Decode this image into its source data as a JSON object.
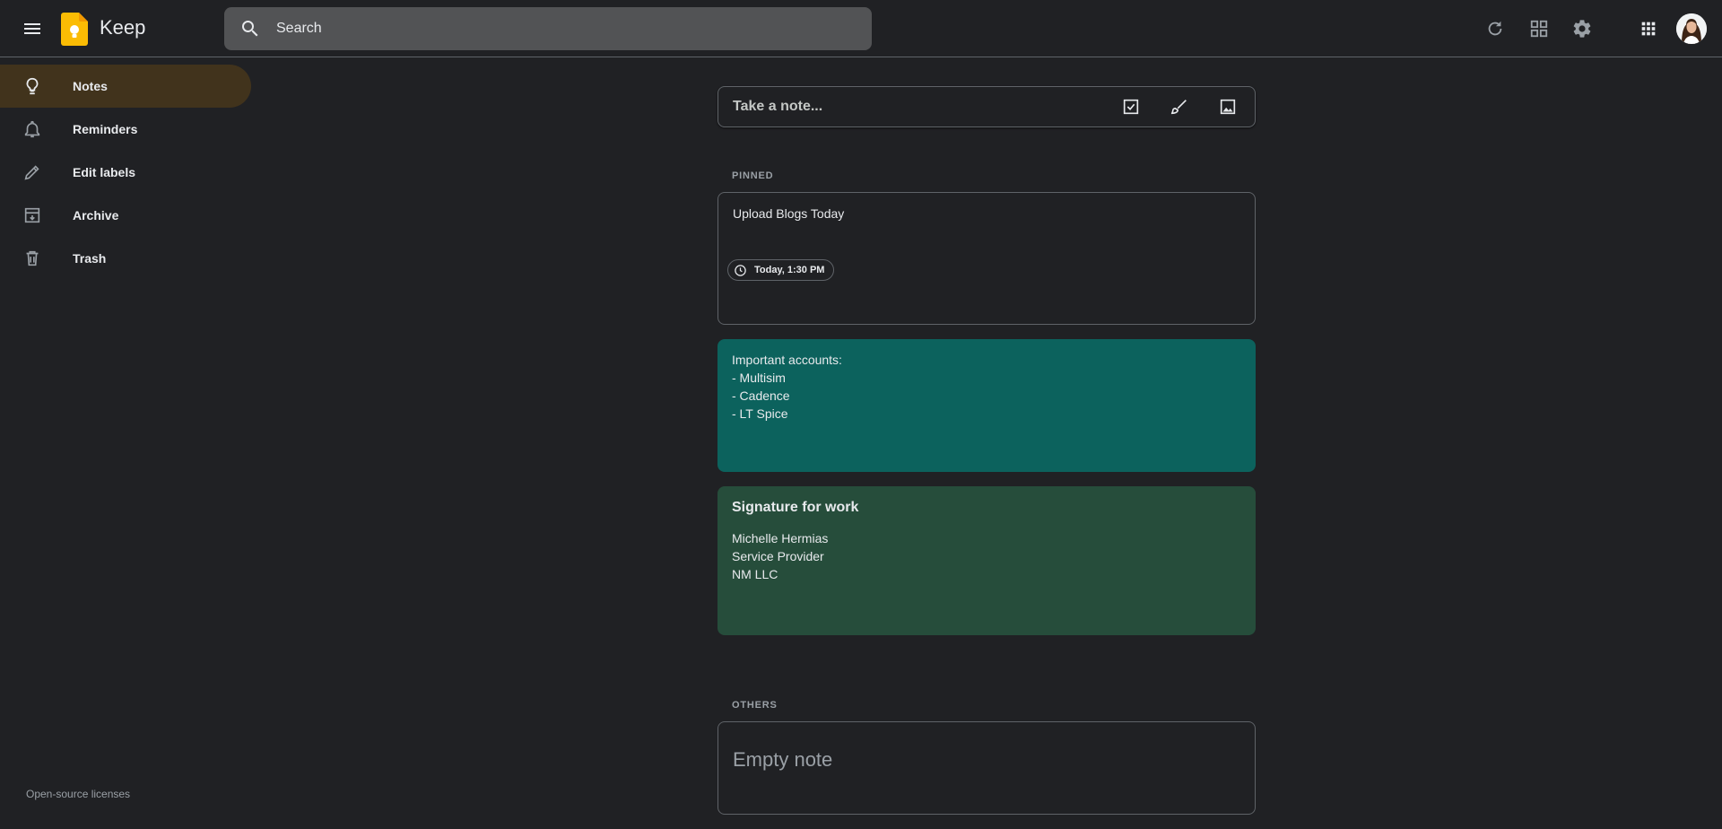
{
  "header": {
    "app_title": "Keep",
    "search_placeholder": "Search",
    "icons": [
      "menu-icon",
      "keep-logo",
      "search-icon",
      "refresh-icon",
      "grid-view-icon",
      "settings-icon",
      "apps-icon",
      "avatar"
    ]
  },
  "sidebar": {
    "items": [
      {
        "label": "Notes",
        "icon": "lightbulb-icon",
        "active": true
      },
      {
        "label": "Reminders",
        "icon": "bell-icon",
        "active": false
      },
      {
        "label": "Edit labels",
        "icon": "pencil-icon",
        "active": false
      },
      {
        "label": "Archive",
        "icon": "archive-icon",
        "active": false
      },
      {
        "label": "Trash",
        "icon": "trash-icon",
        "active": false
      }
    ],
    "footer_link": "Open-source licenses"
  },
  "take_note": {
    "placeholder": "Take a note...",
    "icons": [
      "checkbox-icon",
      "brush-icon",
      "image-icon"
    ]
  },
  "pinned": {
    "label": "PINNED",
    "notes": [
      {
        "title": "Upload Blogs Today",
        "reminder": "Today, 1:30 PM",
        "color": "#202124"
      },
      {
        "lines": [
          "Important accounts:",
          "- Multisim",
          "- Cadence",
          "- LT Spice"
        ],
        "color": "#0c625d"
      },
      {
        "title": "Signature for work",
        "lines": [
          "Michelle Hermias",
          "Service Provider",
          "NM LLC"
        ],
        "color": "#264d3b"
      }
    ]
  },
  "others": {
    "label": "OTHERS",
    "notes": [
      {
        "title": "Empty note",
        "color": "#202124"
      }
    ]
  },
  "colors": {
    "background": "#202124",
    "active_nav": "#41331c",
    "search_bg": "#525355",
    "border": "#5f6368",
    "logo_yellow": "#fbbc04"
  }
}
